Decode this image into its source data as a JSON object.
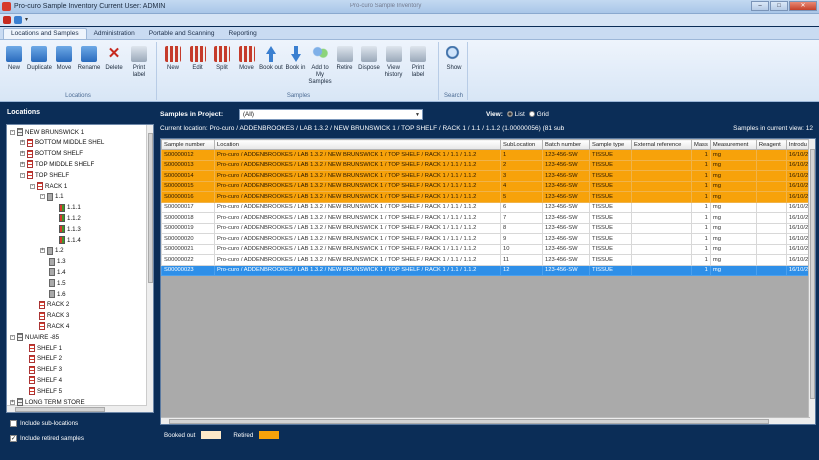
{
  "window": {
    "title": "Pro-curo Sample Inventory   Current User: ADMIN",
    "center_text": "Pro-curo Sample Inventory"
  },
  "tabs": [
    {
      "label": "Locations and Samples",
      "active": true
    },
    {
      "label": "Administration",
      "active": false
    },
    {
      "label": "Portable and Scanning",
      "active": false
    },
    {
      "label": "Reporting",
      "active": false
    }
  ],
  "ribbon": {
    "locations_group": "Locations",
    "locations_buttons": [
      "New",
      "Duplicate",
      "Move",
      "Rename",
      "Delete",
      "Print label"
    ],
    "samples_group": "Samples",
    "samples_buttons": [
      "New",
      "Edit",
      "Split",
      "Move",
      "Book out",
      "Book in",
      "Add to My Samples",
      "Retire",
      "Dispose",
      "View history",
      "Print label"
    ],
    "search_group": "Search",
    "search_buttons": [
      "Show"
    ]
  },
  "left": {
    "header": "Locations",
    "tree": [
      {
        "label": "NEW BRUNSWICK 1",
        "indent": 0,
        "icon": "shelf",
        "exp": "-"
      },
      {
        "label": "BOTTOM MIDDLE SHEL",
        "indent": 1,
        "icon": "rack",
        "exp": "+"
      },
      {
        "label": "BOTTOM SHELF",
        "indent": 1,
        "icon": "rack",
        "exp": "+"
      },
      {
        "label": "TOP MIDDLE SHELF",
        "indent": 1,
        "icon": "rack",
        "exp": "+"
      },
      {
        "label": "TOP SHELF",
        "indent": 1,
        "icon": "rack",
        "exp": "-"
      },
      {
        "label": "RACK 1",
        "indent": 2,
        "icon": "rack",
        "exp": "-"
      },
      {
        "label": "1.1",
        "indent": 3,
        "icon": "gray",
        "exp": "-"
      },
      {
        "label": "1.1.1",
        "indent": 4,
        "icon": "box",
        "exp": ""
      },
      {
        "label": "1.1.2",
        "indent": 4,
        "icon": "box",
        "exp": ""
      },
      {
        "label": "1.1.3",
        "indent": 4,
        "icon": "box",
        "exp": ""
      },
      {
        "label": "1.1.4",
        "indent": 4,
        "icon": "box",
        "exp": ""
      },
      {
        "label": "1.2",
        "indent": 3,
        "icon": "gray",
        "exp": "+"
      },
      {
        "label": "1.3",
        "indent": 3,
        "icon": "gray",
        "exp": ""
      },
      {
        "label": "1.4",
        "indent": 3,
        "icon": "gray",
        "exp": ""
      },
      {
        "label": "1.5",
        "indent": 3,
        "icon": "gray",
        "exp": ""
      },
      {
        "label": "1.6",
        "indent": 3,
        "icon": "gray",
        "exp": ""
      },
      {
        "label": "RACK 2",
        "indent": 2,
        "icon": "rack",
        "exp": ""
      },
      {
        "label": "RACK 3",
        "indent": 2,
        "icon": "rack",
        "exp": ""
      },
      {
        "label": "RACK 4",
        "indent": 2,
        "icon": "rack",
        "exp": ""
      },
      {
        "label": "NUAIRE -85",
        "indent": 0,
        "icon": "shelf",
        "exp": "-"
      },
      {
        "label": "SHELF 1",
        "indent": 1,
        "icon": "rack",
        "exp": ""
      },
      {
        "label": "SHELF 2",
        "indent": 1,
        "icon": "rack",
        "exp": ""
      },
      {
        "label": "SHELF 3",
        "indent": 1,
        "icon": "rack",
        "exp": ""
      },
      {
        "label": "SHELF 4",
        "indent": 1,
        "icon": "rack",
        "exp": ""
      },
      {
        "label": "SHELF 5",
        "indent": 1,
        "icon": "rack",
        "exp": ""
      },
      {
        "label": "LONG TERM STORE",
        "indent": 0,
        "icon": "shelf",
        "exp": "+"
      }
    ],
    "include_sub_locations": "Include sub-locations",
    "include_retired": "Include retired samples"
  },
  "samples_in_project": {
    "label": "Samples in Project:",
    "value": "(All)"
  },
  "view": {
    "label": "View:",
    "list": "List",
    "grid": "Grid"
  },
  "location": {
    "text": "Current location: Pro-curo / ADDENBROOKES / LAB 1.3.2 / NEW BRUNSWICK 1 / TOP SHELF / RACK 1 / 1.1 / 1.1.2  (1.00000056)   (81 sub",
    "count": "Samples in current view: 12"
  },
  "table": {
    "columns": [
      "Sample number",
      "Location",
      "SubLocation",
      "Batch number",
      "Sample type",
      "External reference",
      "Mass",
      "Measurement",
      "Reagent",
      "Introdu"
    ],
    "rows": [
      {
        "state": "retired",
        "cells": [
          "S00000012",
          "Pro-curo / ADDENBROOKES / LAB 1.3.2 / NEW BRUNSWICK 1 / TOP SHELF / RACK 1 / 1.1 / 1.1.2",
          "1",
          "123-456-SW",
          "TISSUE",
          "",
          "1",
          "mg",
          "",
          "16/10/2"
        ]
      },
      {
        "state": "retired",
        "cells": [
          "S00000013",
          "Pro-curo / ADDENBROOKES / LAB 1.3.2 / NEW BRUNSWICK 1 / TOP SHELF / RACK 1 / 1.1 / 1.1.2",
          "2",
          "123-456-SW",
          "TISSUE",
          "",
          "1",
          "mg",
          "",
          "16/10/2"
        ]
      },
      {
        "state": "retired",
        "cells": [
          "S00000014",
          "Pro-curo / ADDENBROOKES / LAB 1.3.2 / NEW BRUNSWICK 1 / TOP SHELF / RACK 1 / 1.1 / 1.1.2",
          "3",
          "123-456-SW",
          "TISSUE",
          "",
          "1",
          "mg",
          "",
          "16/10/2"
        ]
      },
      {
        "state": "retired",
        "cells": [
          "S00000015",
          "Pro-curo / ADDENBROOKES / LAB 1.3.2 / NEW BRUNSWICK 1 / TOP SHELF / RACK 1 / 1.1 / 1.1.2",
          "4",
          "123-456-SW",
          "TISSUE",
          "",
          "1",
          "mg",
          "",
          "16/10/2"
        ]
      },
      {
        "state": "retired",
        "cells": [
          "S00000016",
          "Pro-curo / ADDENBROOKES / LAB 1.3.2 / NEW BRUNSWICK 1 / TOP SHELF / RACK 1 / 1.1 / 1.1.2",
          "5",
          "123-456-SW",
          "TISSUE",
          "",
          "1",
          "mg",
          "",
          "16/10/2"
        ]
      },
      {
        "state": "normal",
        "cells": [
          "S00000017",
          "Pro-curo / ADDENBROOKES / LAB 1.3.2 / NEW BRUNSWICK 1 / TOP SHELF / RACK 1 / 1.1 / 1.1.2",
          "6",
          "123-456-SW",
          "TISSUE",
          "",
          "1",
          "mg",
          "",
          "16/10/2"
        ]
      },
      {
        "state": "normal",
        "cells": [
          "S00000018",
          "Pro-curo / ADDENBROOKES / LAB 1.3.2 / NEW BRUNSWICK 1 / TOP SHELF / RACK 1 / 1.1 / 1.1.2",
          "7",
          "123-456-SW",
          "TISSUE",
          "",
          "1",
          "mg",
          "",
          "16/10/2"
        ]
      },
      {
        "state": "normal",
        "cells": [
          "S00000019",
          "Pro-curo / ADDENBROOKES / LAB 1.3.2 / NEW BRUNSWICK 1 / TOP SHELF / RACK 1 / 1.1 / 1.1.2",
          "8",
          "123-456-SW",
          "TISSUE",
          "",
          "1",
          "mg",
          "",
          "16/10/2"
        ]
      },
      {
        "state": "normal",
        "cells": [
          "S00000020",
          "Pro-curo / ADDENBROOKES / LAB 1.3.2 / NEW BRUNSWICK 1 / TOP SHELF / RACK 1 / 1.1 / 1.1.2",
          "9",
          "123-456-SW",
          "TISSUE",
          "",
          "1",
          "mg",
          "",
          "16/10/2"
        ]
      },
      {
        "state": "normal",
        "cells": [
          "S00000021",
          "Pro-curo / ADDENBROOKES / LAB 1.3.2 / NEW BRUNSWICK 1 / TOP SHELF / RACK 1 / 1.1 / 1.1.2",
          "10",
          "123-456-SW",
          "TISSUE",
          "",
          "1",
          "mg",
          "",
          "16/10/2"
        ]
      },
      {
        "state": "normal",
        "cells": [
          "S00000022",
          "Pro-curo / ADDENBROOKES / LAB 1.3.2 / NEW BRUNSWICK 1 / TOP SHELF / RACK 1 / 1.1 / 1.1.2",
          "11",
          "123-456-SW",
          "TISSUE",
          "",
          "1",
          "mg",
          "",
          "16/10/2"
        ]
      },
      {
        "state": "selected",
        "cells": [
          "S00000023",
          "Pro-curo / ADDENBROOKES / LAB 1.3.2 / NEW BRUNSWICK 1 / TOP SHELF / RACK 1 / 1.1 / 1.1.2",
          "12",
          "123-456-SW",
          "TISSUE",
          "",
          "1",
          "mg",
          "",
          "16/10/2"
        ]
      }
    ]
  },
  "legend": {
    "booked_out": "Booked out",
    "booked_out_color": "#fce8c8",
    "retired": "Retired",
    "retired_color": "#f7a20a"
  },
  "colors": {
    "accent_blue": "#2e8fe8",
    "retired_orange": "#f7a20a",
    "background_navy": "#0b2d57"
  }
}
